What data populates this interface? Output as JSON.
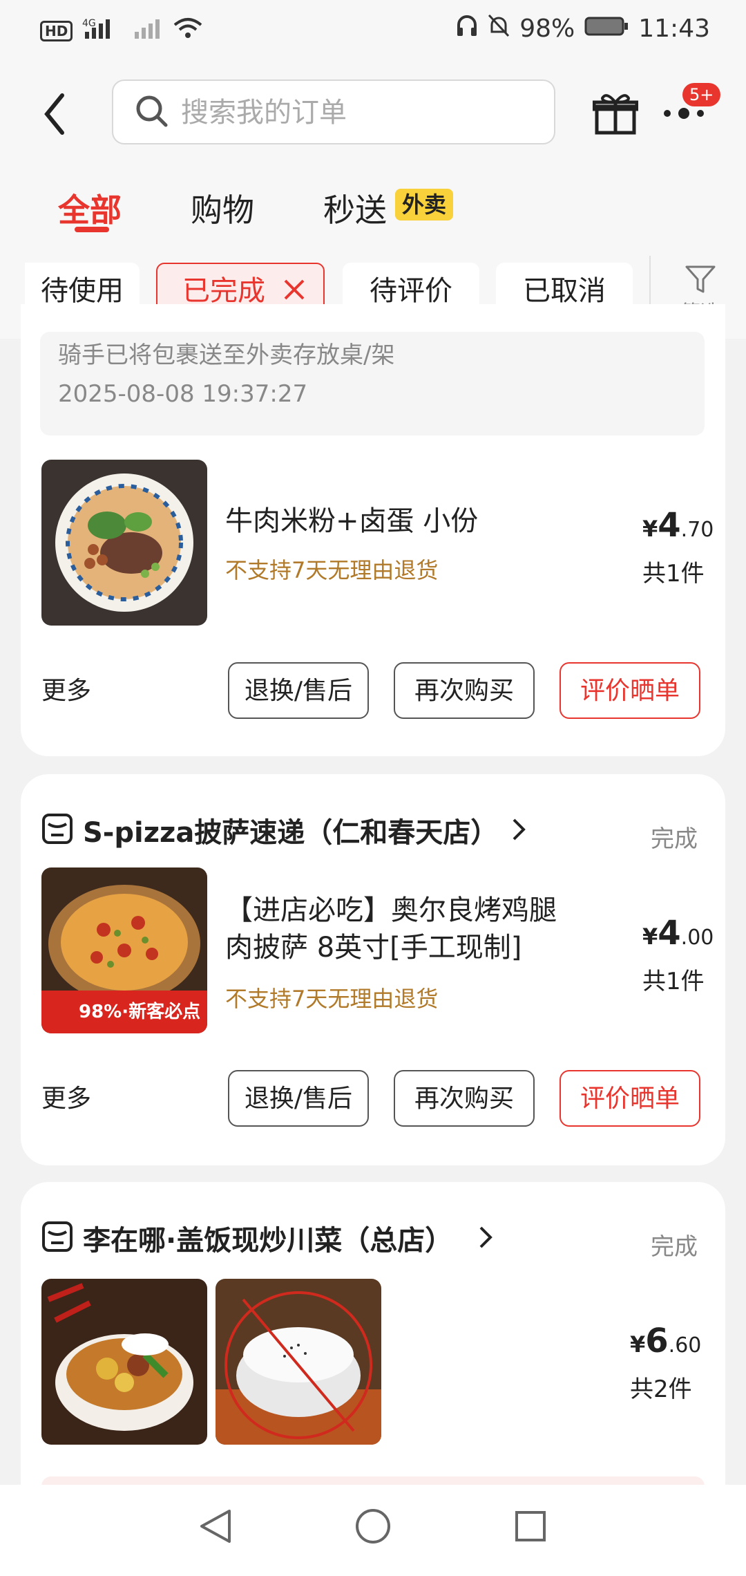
{
  "status": {
    "left_icons": "HD 4G signal wifi",
    "battery": "98%",
    "time": "11:43"
  },
  "header": {
    "search_placeholder": "搜索我的订单",
    "badge": "5+"
  },
  "tabs": [
    {
      "label": "全部"
    },
    {
      "label": "购物"
    },
    {
      "label": "秒送"
    }
  ],
  "takeout_badge": "外卖",
  "filters": [
    {
      "label": "待使用"
    },
    {
      "label": "已完成"
    },
    {
      "label": "待评价"
    },
    {
      "label": "已取消"
    }
  ],
  "filter_label": "筛选",
  "order1": {
    "delivery_note": "骑手已将包裹送至外卖存放桌/架",
    "delivery_time": "2025-08-08 19:37:27",
    "item_title": "牛肉米粉+卤蛋 小份",
    "warning": "不支持7天无理由退货",
    "price_int": "4",
    "price_dec": ".70",
    "qty": "共1件",
    "more": "更多",
    "btn_return": "退换/售后",
    "btn_rebuy": "再次购买",
    "btn_review": "评价晒单"
  },
  "order2": {
    "shop": "S-pizza披萨速递（仁和春天店）",
    "status": "完成",
    "item_title_l1": "【进店必吃】奥尔良烤鸡腿",
    "item_title_l2": "肉披萨 8英寸[手工现制]",
    "warning": "不支持7天无理由退货",
    "price_int": "4",
    "price_dec": ".00",
    "qty": "共1件",
    "img_banner": "98%·新客必点",
    "more": "更多",
    "btn_return": "退换/售后",
    "btn_rebuy": "再次购买",
    "btn_review": "评价晒单"
  },
  "order3": {
    "shop": "李在哪·盖饭现炒川菜（总店）",
    "status": "完成",
    "price_int": "6",
    "price_dec": ".60",
    "qty": "共2件"
  },
  "currency": "¥",
  "colors": {
    "accent": "#e8352e",
    "warn": "#b07a2a",
    "takeout": "#f9d23b"
  }
}
